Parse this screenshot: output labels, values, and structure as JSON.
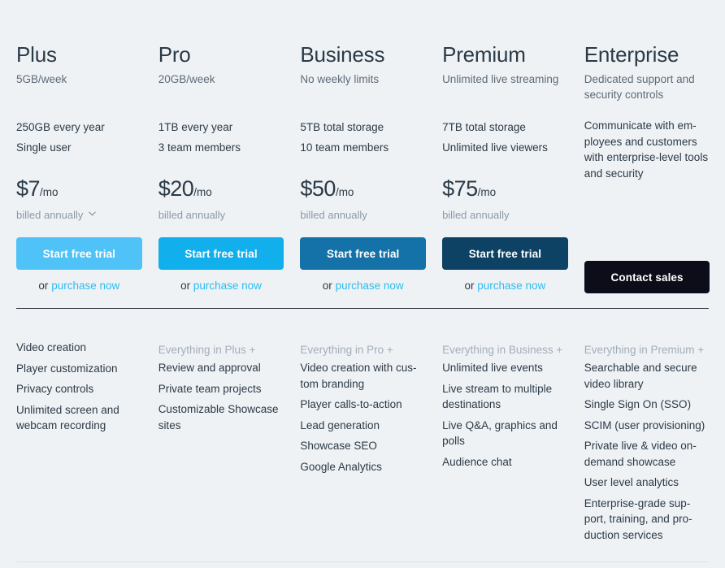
{
  "page": {
    "background_color": "#eff2f5",
    "heading_color": "#2b3a47",
    "muted_color": "#8b99a6",
    "link_color": "#2cbcf0"
  },
  "plans": [
    {
      "name": "Plus",
      "tagline": "5GB/week",
      "specs": [
        "250GB every year",
        "Single user"
      ],
      "description": "",
      "price": "$7",
      "price_period": "/mo",
      "billing_note": "billed annually",
      "has_billing_dropdown": true,
      "cta_label": "Start free trial",
      "cta_color": "#4fc3f7",
      "purchase_prefix": "or ",
      "purchase_label": "purchase now",
      "has_purchase_link": true,
      "features_head": "",
      "features": [
        "Video creation",
        "Player customization",
        "Privacy controls",
        "Unlimited screen and webcam recording"
      ]
    },
    {
      "name": "Pro",
      "tagline": "20GB/week",
      "specs": [
        "1TB every year",
        "3 team members"
      ],
      "description": "",
      "price": "$20",
      "price_period": "/mo",
      "billing_note": "billed annually",
      "has_billing_dropdown": false,
      "cta_label": "Start free trial",
      "cta_color": "#11afec",
      "purchase_prefix": "or ",
      "purchase_label": "purchase now",
      "has_purchase_link": true,
      "features_head": "Everything in Plus +",
      "features": [
        "Review and approval",
        "Private team projects",
        "Customizable Showcase sites"
      ]
    },
    {
      "name": "Business",
      "tagline": "No weekly limits",
      "specs": [
        "5TB total storage",
        "10 team members"
      ],
      "description": "",
      "price": "$50",
      "price_period": "/mo",
      "billing_note": "billed annually",
      "has_billing_dropdown": false,
      "cta_label": "Start free trial",
      "cta_color": "#1572a8",
      "purchase_prefix": "or ",
      "purchase_label": "purchase now",
      "has_purchase_link": true,
      "features_head": "Everything in Pro +",
      "features": [
        "Video creation with cus-tom branding",
        "Player calls-to-action",
        "Lead generation",
        "Showcase SEO",
        "Google Analytics"
      ]
    },
    {
      "name": "Premium",
      "tagline": "Unlimited live streaming",
      "specs": [
        "7TB total storage",
        "Unlimited live viewers"
      ],
      "description": "",
      "price": "$75",
      "price_period": "/mo",
      "billing_note": "billed annually",
      "has_billing_dropdown": false,
      "cta_label": "Start free trial",
      "cta_color": "#0d4265",
      "purchase_prefix": "or ",
      "purchase_label": "purchase now",
      "has_purchase_link": true,
      "features_head": "Everything in Business +",
      "features": [
        "Unlimited live events",
        "Live stream to multiple destinations",
        "Live Q&A, graphics and polls",
        "Audience chat"
      ]
    },
    {
      "name": "Enterprise",
      "tagline": "Dedicated support and security controls",
      "specs": [],
      "description": "Communicate with em-ployees and customers with enterprise-level tools and security",
      "price": "",
      "price_period": "",
      "billing_note": "",
      "has_billing_dropdown": false,
      "cta_label": "Contact sales",
      "cta_color": "#0d0d1a",
      "purchase_prefix": "",
      "purchase_label": "",
      "has_purchase_link": false,
      "features_head": "Everything in Premium +",
      "features": [
        "Searchable and secure video library",
        "Single Sign On (SSO)",
        "SCIM (user provisioning)",
        "Private live & video on-demand showcase",
        "User level analytics",
        "Enterprise-grade sup-port, training, and pro-duction services"
      ]
    }
  ]
}
